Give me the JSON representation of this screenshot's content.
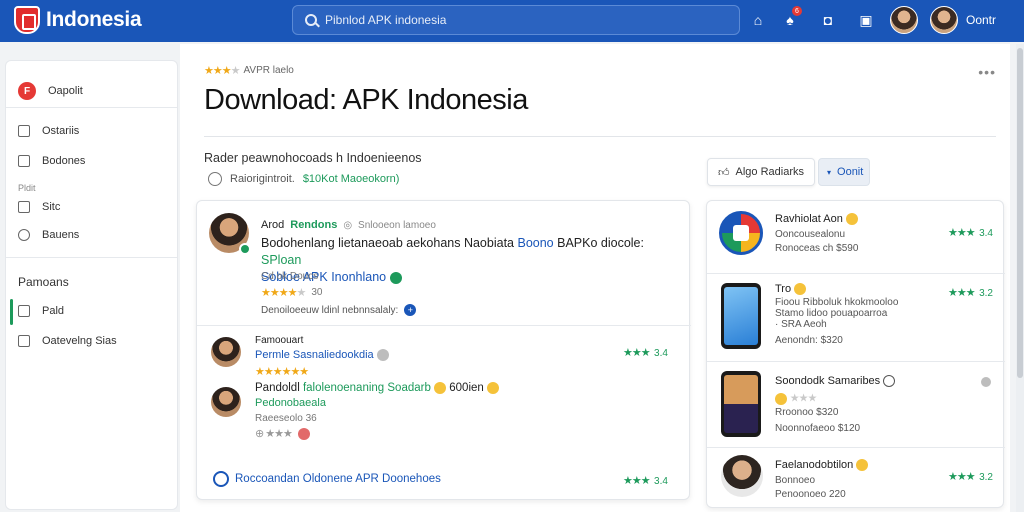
{
  "header": {
    "brand": "Indonesia",
    "search_placeholder": "Pibnlod APK indonesia",
    "notifications_count": "6",
    "account_label": "Oontr"
  },
  "sidebar": {
    "top_item": "Oapolit",
    "items": [
      "Ostariis",
      "Bodones",
      "Sitc",
      "Bauens"
    ],
    "section_small": "Pldit",
    "section_big": "Pamoans",
    "lower_items": [
      "Pald",
      "Oatevelng Sias"
    ]
  },
  "main": {
    "rating_label": "AVPR laelo",
    "title": "Download: APK Indonesia",
    "subtitle": "Rader peawnohocoads h Indoenieenos",
    "meta_text": "Raiorigintroit.",
    "meta_highlight": "$10Kot Maoeokorn)",
    "primary_action": "Algo Radiarks",
    "secondary_action": "Oonit"
  },
  "reviews": {
    "first": {
      "name": "Arod",
      "name_highlight": "Rendons",
      "meta": "Snlooeon lamoeo",
      "body_line1": "Bodohenlang lietanaeoab aekohans Naobiata",
      "body_line1_blue": "Boono",
      "body_line1_mid": "BAPKo diocole:",
      "body_line1_green": "SPloan",
      "body_line2_blue": "Sobloe APK Inonhlano",
      "stat_line": "Cd ok Doucs",
      "stars_count": "30",
      "footer_text": "Denoiloeeuw ldinl nebnnsalaly:"
    },
    "second": {
      "label": "Famoouart",
      "name_blue": "Permle Sasnaliedookdia",
      "score": "3.4"
    },
    "third": {
      "label": "Pandoldl",
      "label_green": "falolenoenaning Soadarb",
      "label_tail": "600ien",
      "name_green": "Pedonobaeala",
      "sub": "Raeeseolo 36"
    },
    "footer_link": "Roccoandan Oldonene APR Doonehoes",
    "footer_score": "3.4"
  },
  "apps": [
    {
      "name": "Ravhiolat Aon",
      "sub1": "Ooncousealonu",
      "sub2": "Ronoceas ch $590",
      "score": "3.4"
    },
    {
      "name": "Tro",
      "sub1": "Fioou Ribboluk hkokmooloo",
      "sub2": "Stamo lidoo pouapoarroa",
      "sub3": "· SRA Aeoh",
      "sub4": "Aenondn: $320",
      "score": "3.2"
    },
    {
      "name": "Soondodk Samaribes",
      "sub1": "Rroonoo $320",
      "sub2": "Noonnofaeoo $120"
    },
    {
      "name": "Faelanodobtilon",
      "sub1": "Bonnoeo",
      "sub2": "Penoonoeo 220",
      "score": "3.2"
    }
  ],
  "colors": {
    "brand": "#1a56b8",
    "accent_green": "#1d9a5b",
    "star": "#f0a818"
  }
}
